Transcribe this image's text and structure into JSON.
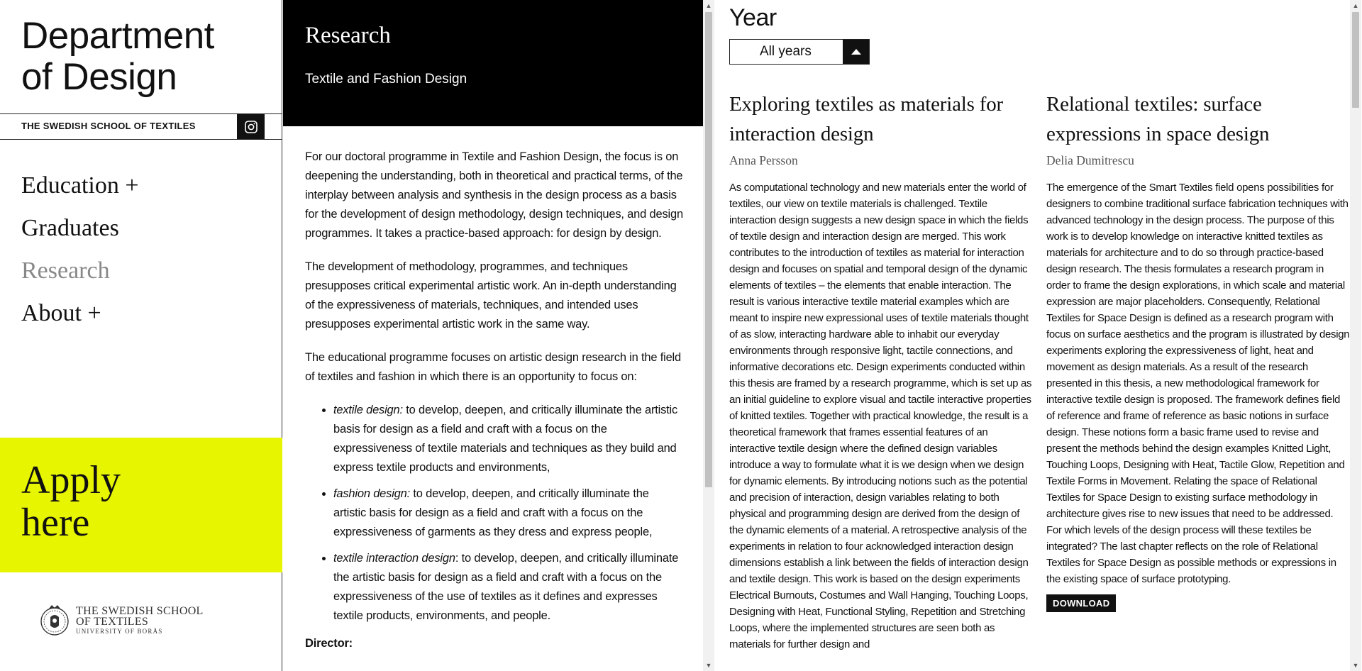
{
  "sidebar": {
    "title_line1": "Department",
    "title_line2": "of Design",
    "school_name": "THE SWEDISH SCHOOL OF TEXTILES",
    "nav": [
      {
        "label": "Education +"
      },
      {
        "label": "Graduates"
      },
      {
        "label": "Research"
      },
      {
        "label": "About +"
      }
    ],
    "apply_line1": "Apply",
    "apply_line2": "here",
    "logo_line1": "THE SWEDISH SCHOOL",
    "logo_line2": "OF TEXTILES",
    "logo_line3": "UNIVERSITY OF BORÅS"
  },
  "middle": {
    "title": "Research",
    "subtitle": "Textile and Fashion Design",
    "p1": "For our doctoral programme in Textile and Fashion Design, the focus is on deepening the understanding, both in theoretical and practical terms, of the interplay between analysis and synthesis in the design process as a basis for the development of design methodology, design techniques, and design programmes. It takes a practice-based approach: for design by design.",
    "p2": "The development of methodology, programmes, and techniques presupposes critical experimental artistic work. An in-depth understanding of the expressiveness of materials, techniques, and intended uses presupposes experimental artistic work in the same way.",
    "p3": "The educational programme focuses on artistic design research in the field of textiles and fashion in which there is an opportunity to focus on:",
    "items": [
      {
        "term": "textile design:",
        "text": " to develop, deepen, and critically illuminate the artistic basis for design as a field and craft with a focus on the expressiveness of textile materials and techniques as they build and express textile products and environments,"
      },
      {
        "term": "fashion design:",
        "text": " to develop, deepen, and critically illuminate the artistic basis for design as a field and craft with a focus on the expressiveness of garments as they dress and express people,"
      },
      {
        "term": "textile interaction design",
        "text": ": to develop, deepen, and critically illuminate the artistic basis for design as a field and craft with a focus on the expressiveness of the use of textiles as it defines and expresses textile products, environments, and people."
      }
    ],
    "director_label": "Director:"
  },
  "filter": {
    "label": "Year",
    "selected": "All years"
  },
  "publications": [
    {
      "title": "Exploring textiles as materials for interaction design",
      "author": "Anna Persson",
      "abstract": "As computational technology and new materials enter the world of textiles, our view on textile materials is challenged. Textile interaction design suggests a new design space in which the fields of textile design and interaction design are merged. This work contributes to the introduction of textiles as material for interaction design and focuses on spatial and temporal design of the dynamic elements of textiles – the elements that enable interaction. The result is various interactive textile material examples which are meant to inspire new expressional uses of textile materials thought of as slow, interacting hardware able to inhabit our everyday environments through responsive light, tactile connections, and informative decorations etc. Design experiments conducted within this thesis are framed by a research programme, which is set up as an initial guideline to explore visual and tactile interactive properties of knitted textiles. Together with practical knowledge, the result is a theoretical framework that frames essential features of an interactive textile design where the defined design variables introduce a way to formulate what it is we design when we design for dynamic elements. By introducing notions such as the potential and precision of interaction, design variables relating to both physical and programming design are derived from the design of the dynamic elements of a material. A retrospective analysis of the experiments in relation to four acknowledged interaction design dimensions establish a link between the fields of interaction design and textile design. This work is based on the design experiments Electrical Burnouts, Costumes and Wall Hanging, Touching Loops, Designing with Heat, Functional Styling, Repetition and Stretching Loops, where the implemented structures are seen both as materials for further design and"
    },
    {
      "title": "Relational textiles: surface expressions in space design",
      "author": "Delia Dumitrescu",
      "abstract": "The emergence of the Smart Textiles field opens possibilities for designers to combine traditional surface fabrication techniques with advanced technology in the design process. The purpose of this work is to develop knowledge on interactive knitted textiles as materials for architecture and to do so through practice-based design research. The thesis formulates a research program in order to frame the design explorations, in which scale and material expression are major placeholders. Consequently, Relational Textiles for Space Design is defined as a research program with focus on surface aesthetics and the program is illustrated by design experiments exploring the expressiveness of light, heat and movement as design materials. As a result of the research presented in this thesis, a new methodological framework for interactive textile design is proposed. The framework defines field of reference and frame of reference as basic notions in surface design. These notions form a basic frame used to revise and present the methods behind the design examples Knitted Light, Touching Loops, Designing with Heat, Tactile Glow, Repetition and Textile Forms in Movement. Relating the space of Relational Textiles for Space Design to existing surface methodology in architecture gives rise to new issues that need to be addressed. For which levels of the design process will these textiles be integrated? The last chapter reflects on the role of Relational Textiles for Space Design as possible methods or expressions in the existing space of surface prototyping.",
      "download_label": "DOWNLOAD"
    }
  ],
  "colors": {
    "apply_bg": "#e8f500",
    "header_bg": "#000000"
  }
}
